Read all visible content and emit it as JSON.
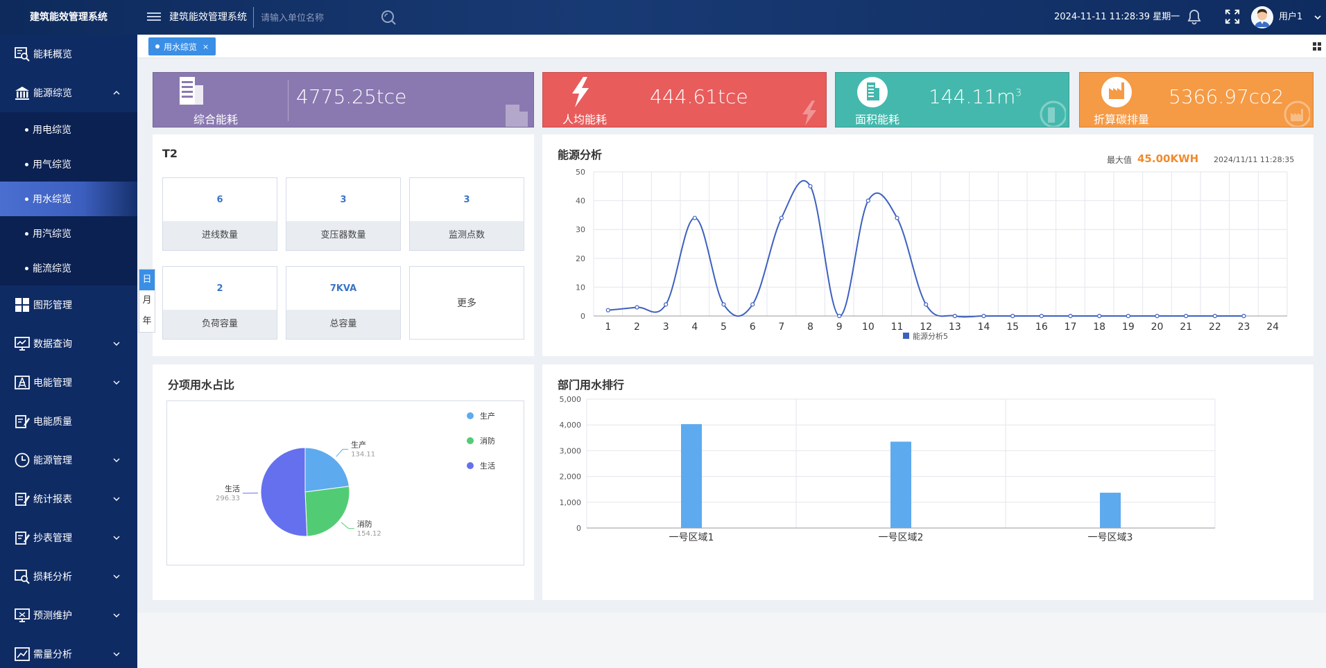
{
  "header": {
    "logo": "建筑能效管理系统",
    "title": "建筑能效管理系统",
    "search_placeholder": "请输入单位名称",
    "datetime": "2024-11-11 11:28:39 星期一",
    "user": "用户1"
  },
  "sidebar": {
    "items": [
      {
        "label": "能耗概览",
        "icon": "monitor-search-icon"
      },
      {
        "label": "能源综览",
        "icon": "bank-icon"
      },
      {
        "label": "图形管理",
        "icon": "grid-icon"
      },
      {
        "label": "数据查询",
        "icon": "monitor-chart-icon"
      },
      {
        "label": "电能管理",
        "icon": "power-tower-icon"
      },
      {
        "label": "电能质量",
        "icon": "document-edit-icon"
      },
      {
        "label": "能源管理",
        "icon": "clock-icon"
      },
      {
        "label": "统计报表",
        "icon": "report-icon"
      },
      {
        "label": "抄表管理",
        "icon": "meter-reading-icon"
      },
      {
        "label": "损耗分析",
        "icon": "analysis-icon"
      },
      {
        "label": "预测维护",
        "icon": "monitor-tool-icon"
      },
      {
        "label": "需量分析",
        "icon": "demand-chart-icon"
      }
    ],
    "subitems": [
      "用电综览",
      "用气综览",
      "用水综览",
      "用汽综览",
      "能流综览"
    ]
  },
  "tab": {
    "label": "用水综览",
    "close": "×"
  },
  "kpis": [
    {
      "label": "综合能耗",
      "value": "4775.25tce",
      "color": "#8a79b0"
    },
    {
      "label": "人均能耗",
      "value": "444.61tce",
      "color": "#e85c5c"
    },
    {
      "label": "面积能耗",
      "value": "144.11m",
      "sup": "3",
      "color": "#44b8ac"
    },
    {
      "label": "折算碳排量",
      "value": "5366.97co2",
      "color": "#f59a45"
    }
  ],
  "t2": {
    "title": "T2",
    "stats": [
      {
        "value": "6",
        "label": "进线数量"
      },
      {
        "value": "3",
        "label": "变压器数量"
      },
      {
        "value": "3",
        "label": "监测点数"
      },
      {
        "value": "2",
        "label": "负荷容量"
      },
      {
        "value": "7KVA",
        "label": "总容量"
      }
    ],
    "more": "更多"
  },
  "period": [
    "日",
    "月",
    "年"
  ],
  "energy": {
    "title": "能源分析",
    "max_label": "最大值",
    "max_value": "45.00KWH",
    "timestamp": "2024/11/11 11:28:35"
  },
  "pie_panel": {
    "title": "分项用水占比"
  },
  "bar_panel": {
    "title": "部门用水排行"
  },
  "chart_data": [
    {
      "type": "line",
      "x": [
        "1",
        "2",
        "3",
        "4",
        "5",
        "6",
        "7",
        "8",
        "9",
        "10",
        "11",
        "12",
        "13",
        "14",
        "15",
        "16",
        "17",
        "18",
        "19",
        "20",
        "21",
        "22",
        "23",
        "24"
      ],
      "series": [
        {
          "name": "能源分析5",
          "values": [
            2,
            3,
            4,
            34,
            4,
            4,
            34,
            45,
            0,
            40,
            34,
            4,
            0,
            0,
            0,
            0,
            0,
            0,
            0,
            0,
            0,
            0,
            0,
            null
          ],
          "color": "#3d5fbf"
        }
      ],
      "ylim": [
        0,
        50
      ],
      "yticks": [
        0,
        10,
        20,
        30,
        40,
        50
      ],
      "grid": true,
      "legend": "bottom-center"
    },
    {
      "type": "pie",
      "labels": [
        "生产",
        "消防",
        "生活"
      ],
      "values": [
        134.11,
        154.12,
        296.33
      ],
      "colors": [
        "#5eaaee",
        "#52cc74",
        "#6470ee"
      ],
      "legend": "top-right"
    },
    {
      "type": "bar",
      "categories": [
        "一号区域1",
        "一号区域2",
        "一号区域3"
      ],
      "values": [
        4030,
        3350,
        1370
      ],
      "ylim": [
        0,
        5000
      ],
      "yticks": [
        "0",
        "1,000",
        "2,000",
        "3,000",
        "4,000",
        "5,000"
      ],
      "color": "#5eaaee",
      "grid": true
    }
  ]
}
